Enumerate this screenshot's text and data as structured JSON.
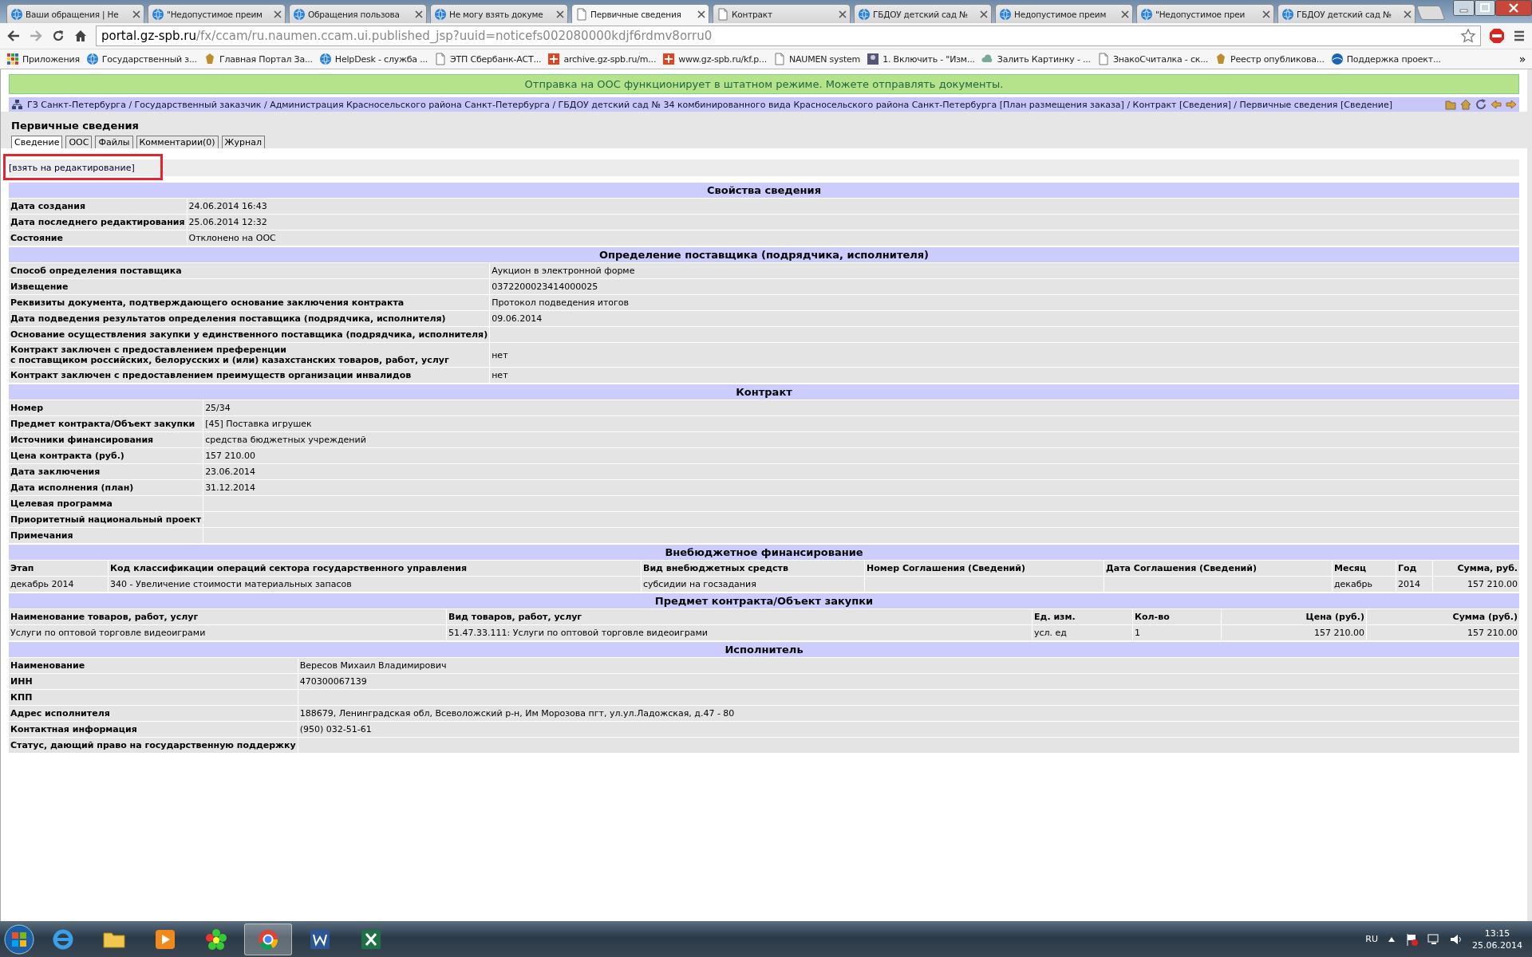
{
  "browser_tabs": [
    {
      "title": "Ваши обращения | Не",
      "selected": false
    },
    {
      "title": "\"Недопустимое преим",
      "selected": false
    },
    {
      "title": "Обращения пользова",
      "selected": false
    },
    {
      "title": "Не могу взять докуме",
      "selected": false
    },
    {
      "title": "Первичные сведения",
      "selected": true
    },
    {
      "title": "Контракт",
      "selected": false
    },
    {
      "title": "ГБДОУ детский сад №",
      "selected": false
    },
    {
      "title": "Недопустимое преим",
      "selected": false
    },
    {
      "title": "\"Недопустимое преи",
      "selected": false
    },
    {
      "title": "ГБДОУ детский сад №",
      "selected": false
    }
  ],
  "address_bar": {
    "host": "portal.gz-spb.ru",
    "path": "/fx/ccam/ru.naumen.ccam.ui.published_jsp?uuid=noticefs002080000kdjf6rdmv8orru0"
  },
  "bookmarks": [
    "Приложения",
    "Государственный з...",
    "Главная Портал За...",
    "HelpDesk - служба ...",
    "ЭТП Сбербанк-АСТ...",
    "archive.gz-spb.ru/m...",
    "www.gz-spb.ru/kf.p...",
    "NAUMEN system",
    "1. Включить - \"Изм...",
    "Залить Картинку - ...",
    "ЗнакоСчиталка - ск...",
    "Реестр опубликова...",
    "Поддержка проект..."
  ],
  "bookmarks_overflow": "»",
  "notice": "Отправка на ООС функционирует в штатном режиме. Можете отправлять документы.",
  "breadcrumb": "ГЗ Санкт-Петербурга / Государственный заказчик / Администрация Красносельского района Санкт-Петербурга / ГБДОУ детский сад № 34 комбинированного вида Красносельского района Санкт-Петербурга [План размещения заказа] / Контракт [Сведения] / Первичные сведения [Сведение]",
  "page_title": "Первичные сведения",
  "doc_tabs": [
    {
      "label": "Сведение",
      "selected": true
    },
    {
      "label": "ООС",
      "selected": false
    },
    {
      "label": "Файлы",
      "selected": false
    },
    {
      "label": "Комментарии(0)",
      "selected": false
    },
    {
      "label": "Журнал",
      "selected": false
    }
  ],
  "edit_link": "[взять на редактирование]",
  "sections": [
    {
      "kind": "fields",
      "title": "Свойства сведения",
      "fields": [
        {
          "label": "Дата создания",
          "value": "24.06.2014 16:43"
        },
        {
          "label": "Дата последнего редактирования",
          "value": "25.06.2014 12:32"
        },
        {
          "label": "Состояние",
          "value": "Отклонено на ООС"
        }
      ]
    },
    {
      "kind": "fields",
      "title": "Определение поставщика (подрядчика, исполнителя)",
      "fields": [
        {
          "label": "Способ определения поставщика",
          "value": "Аукцион в электронной форме"
        },
        {
          "label": "Извещение",
          "value": "0372200023414000025"
        },
        {
          "label": "Реквизиты документа, подтверждающего основание заключения контракта",
          "value": "Протокол подведения итогов"
        },
        {
          "label": "Дата подведения результатов определения поставщика (подрядчика, исполнителя)",
          "value": "09.06.2014"
        },
        {
          "label": "Основание осуществления закупки у единственного поставщика (подрядчика, исполнителя)"
        },
        {
          "label": "Контракт заключен с предоставлением преференции\nс поставщиком российских, белорусских и (или) казахстанских товаров, работ, услуг",
          "value": "нет"
        },
        {
          "label": "Контракт заключен с предоставлением преимуществ организации инвалидов",
          "value": "нет"
        }
      ]
    },
    {
      "kind": "fields",
      "title": "Контракт",
      "fields": [
        {
          "label": "Номер",
          "value": "25/34"
        },
        {
          "label": "Предмет контракта/Объект закупки",
          "value": "[45] Поставка игрушек"
        },
        {
          "label": "Источники финансирования",
          "value": "средства бюджетных учреждений"
        },
        {
          "label": "Цена контракта (руб.)",
          "value": "157 210.00"
        },
        {
          "label": "Дата заключения",
          "value": "23.06.2014"
        },
        {
          "label": "Дата исполнения (план)",
          "value": "31.12.2014"
        },
        {
          "label": "Целевая программа"
        },
        {
          "label": "Приоритетный национальный проект"
        },
        {
          "label": "Примечания"
        }
      ]
    },
    {
      "kind": "table",
      "title": "Внебюджетное финансирование",
      "columns": [
        "Этап",
        "Код классификации операций сектора государственного управления",
        "Вид внебюджетных средств",
        "Номер Соглашения (Сведений)",
        "Дата Соглашения (Сведений)",
        "Месяц",
        "Год",
        "Сумма, руб."
      ],
      "rows": [
        [
          "декабрь 2014",
          "340 - Увеличение стоимости материальных запасов",
          "субсидии на госзадания",
          "",
          "",
          "декабрь",
          "2014",
          "157 210.00"
        ]
      ]
    },
    {
      "kind": "table",
      "title": "Предмет контракта/Объект закупки",
      "columns": [
        "Наименование товаров, работ, услуг",
        "Вид товаров, работ, услуг",
        "Ед. изм.",
        "Кол-во",
        "Цена (руб.)",
        "Сумма (руб.)"
      ],
      "rows": [
        [
          "Услуги по оптовой торговле видеоиграми",
          "51.47.33.111: Услуги по оптовой торговле видеоиграми",
          "усл. ед",
          "1",
          "157 210.00",
          "157 210.00"
        ]
      ]
    },
    {
      "kind": "fields",
      "title": "Исполнитель",
      "fields": [
        {
          "label": "Наименование",
          "value": "Вересов Михаил Владимирович"
        },
        {
          "label": "ИНН",
          "value": "470300067139"
        },
        {
          "label": "КПП"
        },
        {
          "label": "Адрес исполнителя",
          "value": "188679, Ленинградская обл, Всеволожский р-н, Им Морозова пгт, ул.ул.Ладожская, д.47 - 80"
        },
        {
          "label": "Контактная информация",
          "value": "(950) 032-51-61"
        },
        {
          "label": "Статус, дающий право на государственную поддержку"
        }
      ]
    }
  ],
  "taskbar": {
    "language": "RU",
    "time": "13:15",
    "date": "25.06.2014"
  }
}
